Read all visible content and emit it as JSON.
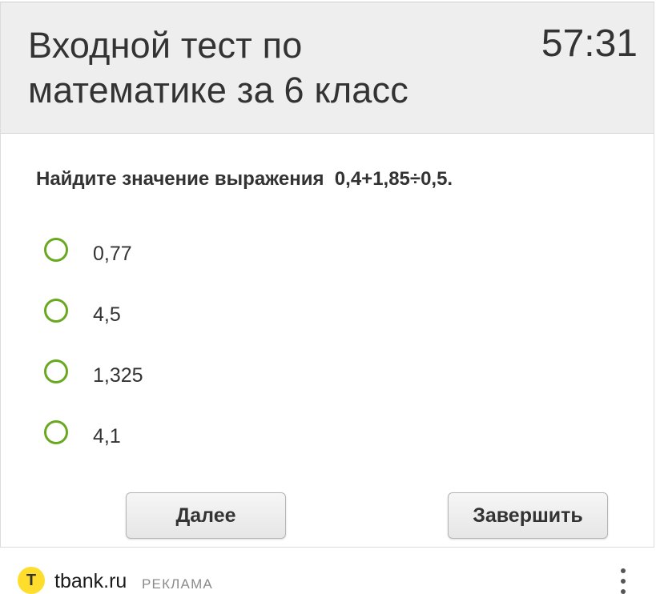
{
  "test": {
    "title": "Входной тест по математике за 6 класс",
    "timer": "57:31",
    "question": "Найдите значение выражения  0,4+1,85÷0,5.",
    "options": [
      {
        "label": "0,77"
      },
      {
        "label": "4,5"
      },
      {
        "label": "1,325"
      },
      {
        "label": "4,1"
      }
    ],
    "next_label": "Далее",
    "finish_label": "Завершить",
    "accent_color": "#6aa81f"
  },
  "ad": {
    "logo_letter": "Т",
    "domain": "tbank.ru",
    "label": "РЕКЛАМА",
    "menu_icon": "more-vertical-icon"
  }
}
